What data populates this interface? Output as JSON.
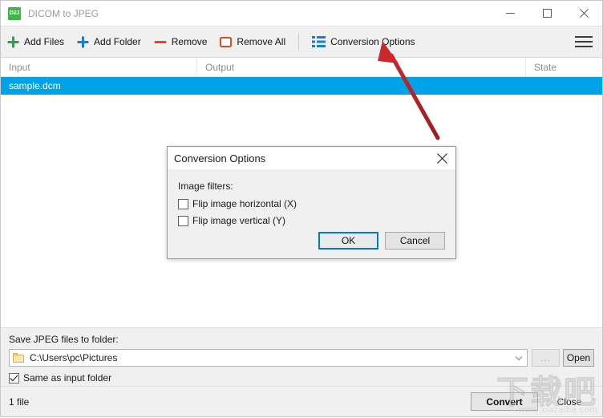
{
  "window": {
    "app_icon_text": "D2J",
    "title": "DICOM to JPEG",
    "minimize_label": "minimize",
    "maximize_label": "maximize",
    "close_label": "close"
  },
  "toolbar": {
    "items": [
      {
        "label": "Add Files",
        "icon": "plus-green-icon",
        "color": "#22aa3c"
      },
      {
        "label": "Add Folder",
        "icon": "plus-blue-icon",
        "color": "#1a7fd4"
      },
      {
        "label": "Remove",
        "icon": "dash-red-icon",
        "color": "#e24a1c"
      },
      {
        "label": "Remove All",
        "icon": "square-red-icon",
        "color": "#e24a1c"
      },
      {
        "label": "Conversion Options",
        "icon": "list-blue-icon",
        "color": "#1a7fd4"
      }
    ],
    "menu_label": "Menu"
  },
  "file_list": {
    "columns": [
      "Input",
      "Output",
      "State"
    ],
    "rows": [
      {
        "input": "sample.dcm",
        "output": "",
        "state": "",
        "selected": true
      }
    ],
    "selection_color": "#00a2e8"
  },
  "output_panel": {
    "label": "Save JPEG files to folder:",
    "path": "C:\\Users\\pc\\Pictures",
    "browse_label": "...",
    "open_label": "Open",
    "same_as_input_label": "Same as input folder",
    "same_as_input_checked": true
  },
  "statusbar": {
    "file_count": "1 file",
    "convert_label": "Convert",
    "close_label": "Close"
  },
  "dialog": {
    "title": "Conversion Options",
    "section_label": "Image filters:",
    "checkboxes": [
      {
        "label": "Flip image horizontal (X)",
        "checked": false
      },
      {
        "label": "Flip image vertical (Y)",
        "checked": false
      }
    ],
    "ok_label": "OK",
    "cancel_label": "Cancel",
    "focus_color": "#0078d7"
  },
  "annotation": {
    "arrow_color": "#b52025",
    "points_to": "Conversion Options"
  },
  "watermark": {
    "main": "下载吧",
    "sub": "www.xiazaiba.com"
  }
}
